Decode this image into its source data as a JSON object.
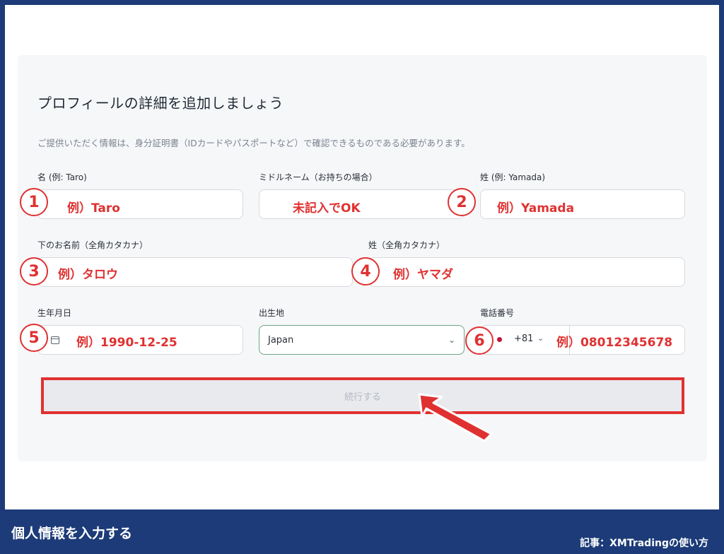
{
  "form": {
    "title": "プロフィールの詳細を追加しましょう",
    "description": "ご提供いただく情報は、身分証明書（IDカードやパスポートなど）で確認できるものである必要があります。",
    "fields": {
      "first_name": {
        "label": "名 (例: Taro)",
        "annotation": "例）Taro",
        "number": "1"
      },
      "middle_name": {
        "label": "ミドルネーム（お持ちの場合）",
        "annotation": "未記入でOK"
      },
      "last_name": {
        "label": "姓 (例: Yamada)",
        "annotation": "例）Yamada",
        "number": "2"
      },
      "first_name_kana": {
        "label": "下のお名前（全角カタカナ）",
        "annotation": "例）タロウ",
        "number": "3"
      },
      "last_name_kana": {
        "label": "姓（全角カタカナ）",
        "annotation": "例）ヤマダ",
        "number": "4"
      },
      "birthdate": {
        "label": "生年月日",
        "annotation": "例）1990-12-25",
        "number": "5"
      },
      "birthplace": {
        "label": "出生地",
        "value": "Japan"
      },
      "phone": {
        "label": "電話番号",
        "country_code": "+81",
        "annotation": "例）08012345678",
        "number": "6"
      }
    },
    "submit_label": "続行する"
  },
  "footer": {
    "title": "個人情報を入力する",
    "credit": "記事：XMTradingの使い方"
  },
  "colors": {
    "frame": "#1c3b78",
    "annotation_red": "#e03131",
    "select_border": "#6ca882"
  },
  "icons": [
    "calendar-icon",
    "chevron-down-icon",
    "flag-icon",
    "arrow-pointer-icon"
  ]
}
